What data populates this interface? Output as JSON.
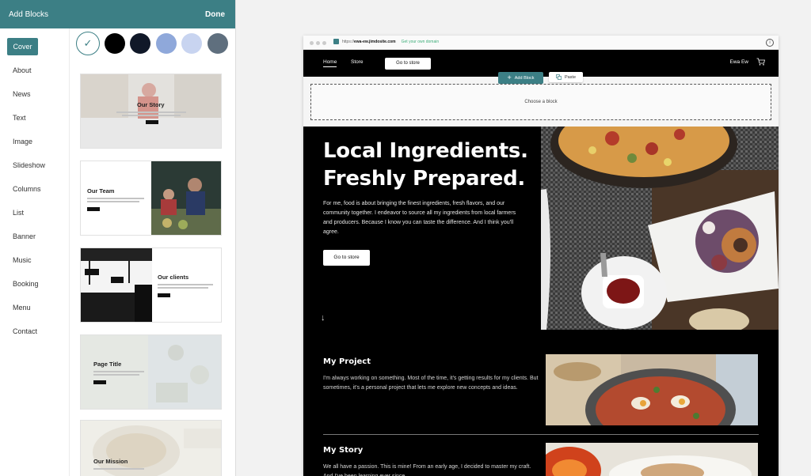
{
  "panel": {
    "title": "Add Blocks",
    "done_label": "Done",
    "categories": [
      "Cover",
      "About",
      "News",
      "Text",
      "Image",
      "Slideshow",
      "Columns",
      "List",
      "Banner",
      "Music",
      "Booking",
      "Menu",
      "Contact"
    ],
    "active_category": "Cover",
    "swatches": [
      "#ffffff",
      "#000000",
      "#101828",
      "#8fa8da",
      "#c8d4f0",
      "#5f6f7e"
    ],
    "thumbnails": [
      "Our Story",
      "Our Team",
      "Our clients",
      "Page Title",
      "Our Mission"
    ]
  },
  "browser": {
    "url": "https://ewa-ew.jimdosite.com",
    "url_prefix": "https://",
    "url_host": "ewa-ew.jimdosite.com",
    "domain_link": "Get your own domain",
    "info_icon": "i"
  },
  "site_nav": {
    "home": "Home",
    "store": "Store",
    "store_button": "Go to store",
    "user": "Ewa Ew"
  },
  "editor": {
    "add_block": "Add Block",
    "paste": "Paste",
    "choose_block": "Choose a block"
  },
  "hero": {
    "title_line1": "Local Ingredients.",
    "title_line2": "Freshly Prepared.",
    "text": "For me, food is about bringing the finest ingredients, fresh flavors, and our community together. I endeavor to source all my ingredients from local farmers and producers. Because I know you can taste the difference. And I think you'll agree.",
    "button": "Go to store",
    "arrow": "↓"
  },
  "projects": {
    "project_title": "My Project",
    "project_text": "I'm always working on something. Most of the time, it's getting results for my clients. But sometimes, it's a personal project that lets me explore new concepts and ideas.",
    "story_title": "My Story",
    "story_text": "We all have a passion. This is mine! From an early age, I decided to master my craft. And I've been learning ever since."
  },
  "colors": {
    "accent": "#3c7f85",
    "domain_link": "#3fae7a"
  }
}
